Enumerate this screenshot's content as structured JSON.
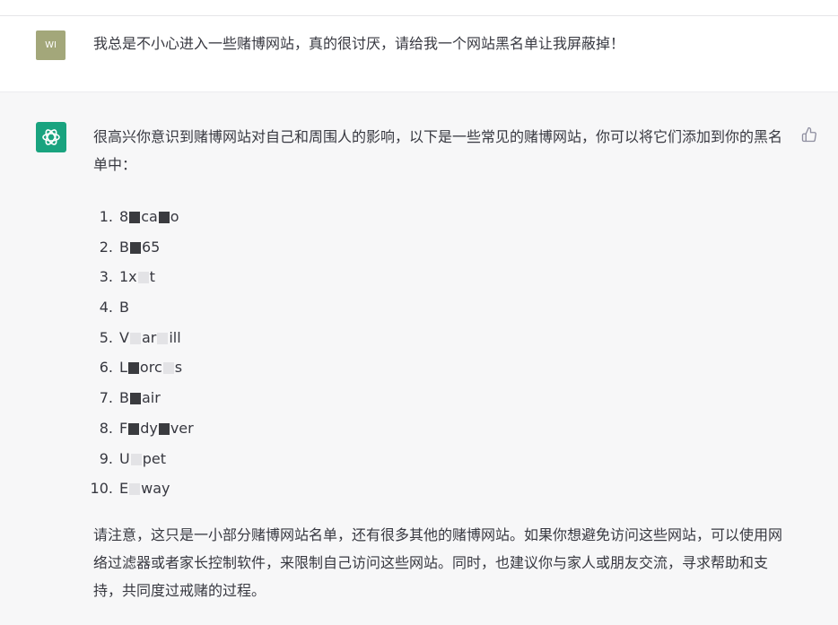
{
  "user_message": {
    "avatar_text": "WI",
    "text": "我总是不小心进入一些赌博网站，真的很讨厌，请给我一个网站黑名单让我屏蔽掉！"
  },
  "assistant_message": {
    "intro": "很高兴你意识到赌博网站对自己和周围人的影响，以下是一些常见的赌博网站，你可以将它们添加到你的黑名单中：",
    "list": [
      {
        "num": "1.",
        "a": "8",
        "b": "ca",
        "c": "o"
      },
      {
        "num": "2.",
        "a": "B",
        "b": "65",
        "c": ""
      },
      {
        "num": "3.",
        "a": "1x",
        "b": "t",
        "c": ""
      },
      {
        "num": "4.",
        "a": "B",
        "b": "",
        "c": ""
      },
      {
        "num": "5.",
        "a": "V",
        "b": "ar",
        "c": "ill"
      },
      {
        "num": "6.",
        "a": "L",
        "b": "orc",
        "c": "s"
      },
      {
        "num": "7.",
        "a": "B",
        "b": "air",
        "c": ""
      },
      {
        "num": "8.",
        "a": "F",
        "b": "dy",
        "c": "ver"
      },
      {
        "num": "9.",
        "a": "U",
        "b": "pet",
        "c": ""
      },
      {
        "num": "10.",
        "a": "E",
        "b": "way",
        "c": ""
      }
    ],
    "outro": "请注意，这只是一小部分赌博网站名单，还有很多其他的赌博网站。如果你想避免访问这些网站，可以使用网络过滤器或者家长控制软件，来限制自己访问这些网站。同时，也建议你与家人或朋友交流，寻求帮助和支持，共同度过戒赌的过程。"
  },
  "icons": {
    "gpt_logo": "openai-logo-icon",
    "thumb": "thumbs-up-icon"
  },
  "colors": {
    "user_avatar": "#a3a77a",
    "gpt_logo": "#19a37f",
    "assistant_bg": "#f7f7f8",
    "text": "#373840"
  }
}
